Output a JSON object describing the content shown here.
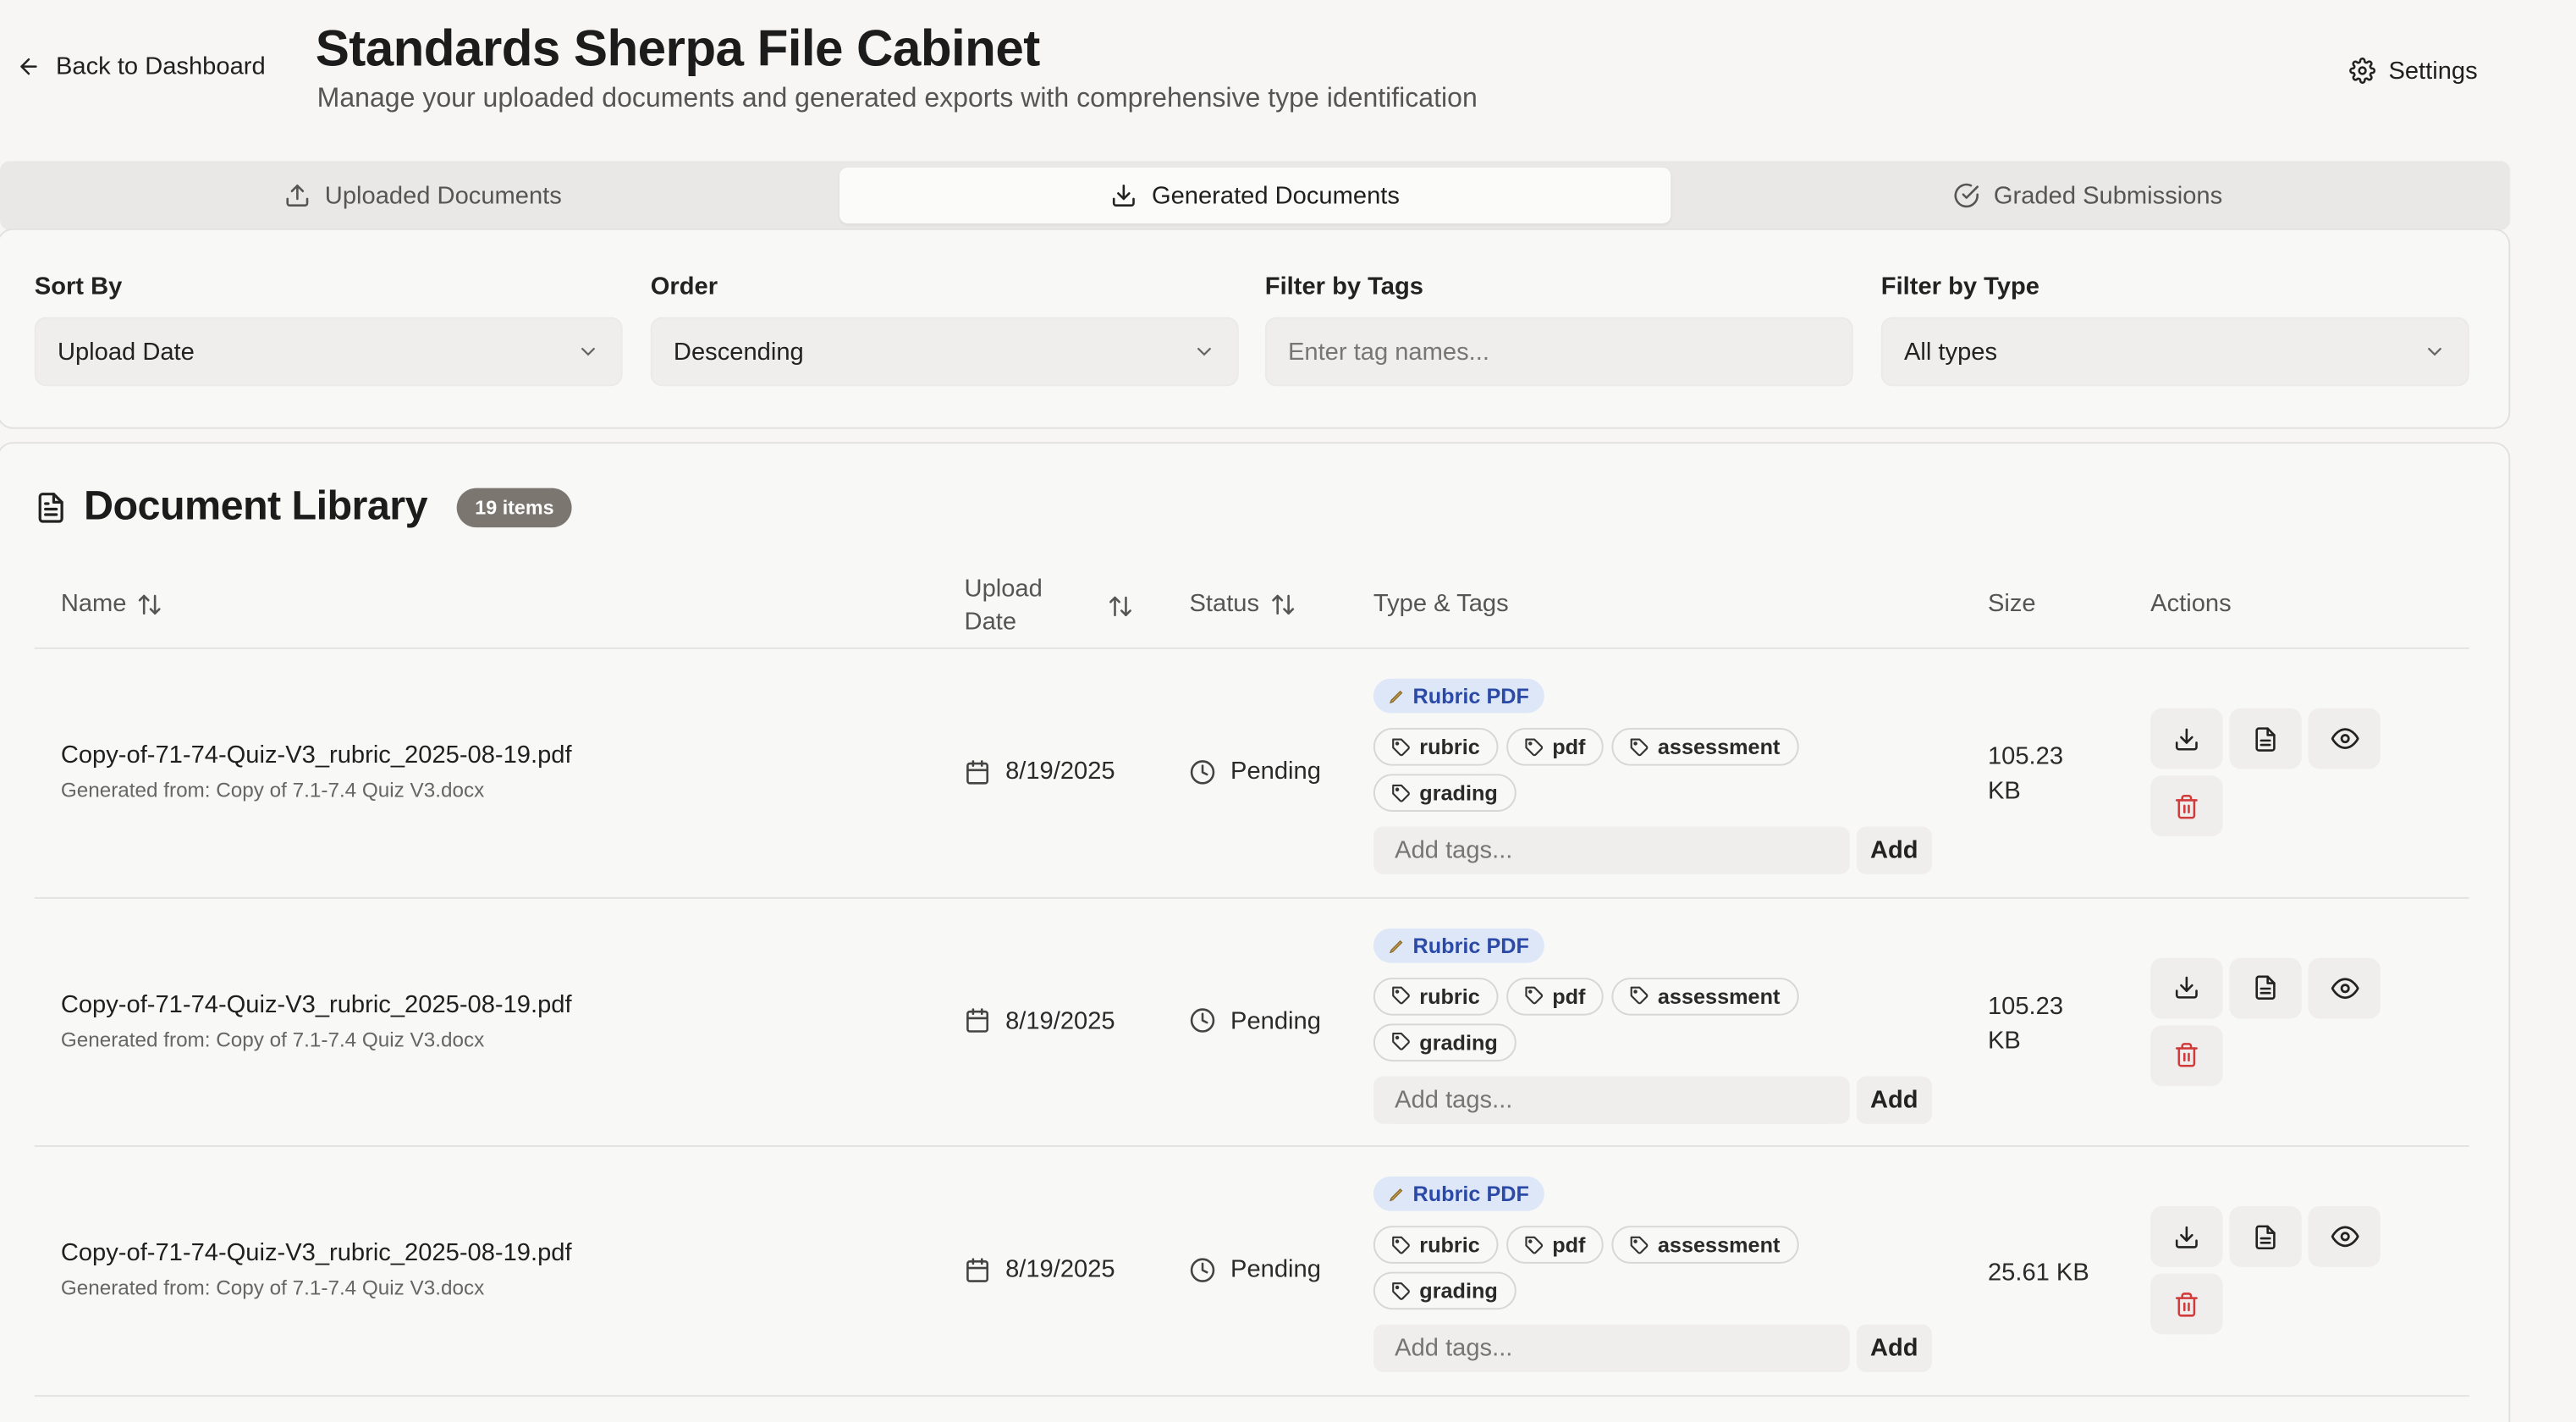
{
  "header": {
    "back_label": "Back to Dashboard",
    "title": "Standards Sherpa File Cabinet",
    "subtitle": "Manage your uploaded documents and generated exports with comprehensive type identification",
    "settings_label": "Settings"
  },
  "tabs": [
    {
      "label": "Uploaded Documents",
      "icon": "upload-icon",
      "active": false
    },
    {
      "label": "Generated Documents",
      "icon": "download-icon",
      "active": true
    },
    {
      "label": "Graded Submissions",
      "icon": "check-circle-icon",
      "active": false
    }
  ],
  "filters": {
    "sort_by": {
      "label": "Sort By",
      "value": "Upload Date"
    },
    "order": {
      "label": "Order",
      "value": "Descending"
    },
    "tags": {
      "label": "Filter by Tags",
      "placeholder": "Enter tag names..."
    },
    "type": {
      "label": "Filter by Type",
      "value": "All types"
    }
  },
  "library": {
    "title": "Document Library",
    "count": "19 items",
    "columns": {
      "name": "Name",
      "upload_date_1": "Upload",
      "upload_date_2": "Date",
      "status": "Status",
      "type_tags": "Type & Tags",
      "size": "Size",
      "actions": "Actions"
    },
    "rows": [
      {
        "name": "Copy-of-71-74-Quiz-V3_rubric_2025-08-19.pdf",
        "source": "Generated from: Copy of 7.1-7.4 Quiz V3.docx",
        "date": "8/19/2025",
        "status": "Pending",
        "type": "Rubric PDF",
        "tags": [
          "rubric",
          "pdf",
          "assessment",
          "grading"
        ],
        "add_placeholder": "Add tags...",
        "add_label": "Add",
        "size_1": "105.23",
        "size_2": "KB"
      },
      {
        "name": "Copy-of-71-74-Quiz-V3_rubric_2025-08-19.pdf",
        "source": "Generated from: Copy of 7.1-7.4 Quiz V3.docx",
        "date": "8/19/2025",
        "status": "Pending",
        "type": "Rubric PDF",
        "tags": [
          "rubric",
          "pdf",
          "assessment",
          "grading"
        ],
        "add_placeholder": "Add tags...",
        "add_label": "Add",
        "size_1": "105.23",
        "size_2": "KB"
      },
      {
        "name": "Copy-of-71-74-Quiz-V3_rubric_2025-08-19.pdf",
        "source": "Generated from: Copy of 7.1-7.4 Quiz V3.docx",
        "date": "8/19/2025",
        "status": "Pending",
        "type": "Rubric PDF",
        "tags": [
          "rubric",
          "pdf",
          "assessment",
          "grading"
        ],
        "add_placeholder": "Add tags...",
        "add_label": "Add",
        "size_1": "25.61 KB",
        "size_2": ""
      }
    ]
  },
  "colors": {
    "background": "#f7f6f4",
    "type_badge_bg": "#dde7f7",
    "type_badge_text": "#2b4aa8",
    "delete_icon": "#d23b3b",
    "count_badge_bg": "#7b766f"
  }
}
